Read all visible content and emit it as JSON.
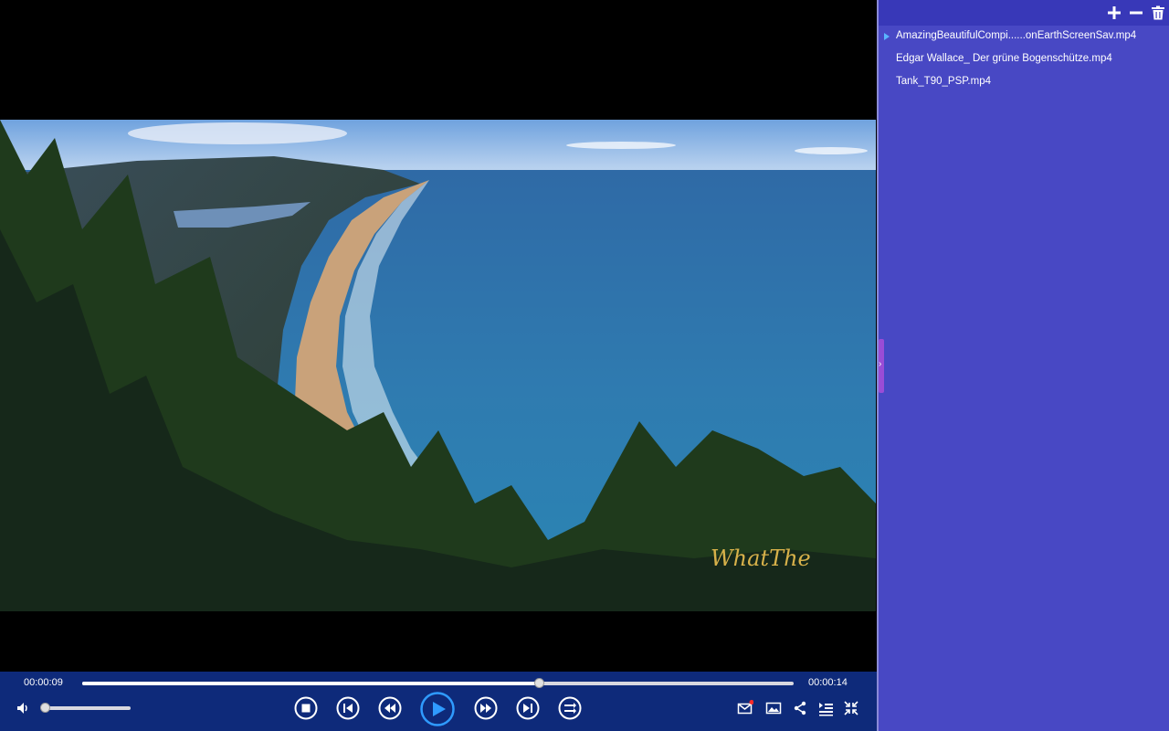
{
  "player": {
    "video_watermark": "WhatThe",
    "time_elapsed": "00:00:09",
    "time_total": "00:00:14",
    "progress_fraction": 0.642,
    "volume_fraction": 0.03,
    "accent_color": "#2f9bff",
    "controls": [
      {
        "name": "stop-button",
        "icon": "stop-icon"
      },
      {
        "name": "previous-button",
        "icon": "skip-previous-icon"
      },
      {
        "name": "rewind-button",
        "icon": "rewind-icon"
      },
      {
        "name": "play-button",
        "icon": "play-icon"
      },
      {
        "name": "fast-forward-button",
        "icon": "fast-forward-icon"
      },
      {
        "name": "next-button",
        "icon": "skip-next-icon"
      },
      {
        "name": "playback-mode-button",
        "icon": "repeat-list-icon"
      }
    ],
    "right_tools": [
      "mail-icon",
      "picture-icon",
      "share-icon",
      "playlist-toggle-icon",
      "collapse-icon"
    ]
  },
  "sidebar": {
    "toolbar": [
      "add-icon",
      "remove-icon",
      "trash-icon"
    ],
    "playlist": [
      {
        "title": "AmazingBeautifulCompi......onEarthScreenSav.mp4",
        "playing": true
      },
      {
        "title": "Edgar Wallace_ Der grüne Bogenschütze.mp4",
        "playing": false
      },
      {
        "title": "Tank_T90_PSP.mp4",
        "playing": false
      }
    ],
    "handle_glyph": "›"
  }
}
